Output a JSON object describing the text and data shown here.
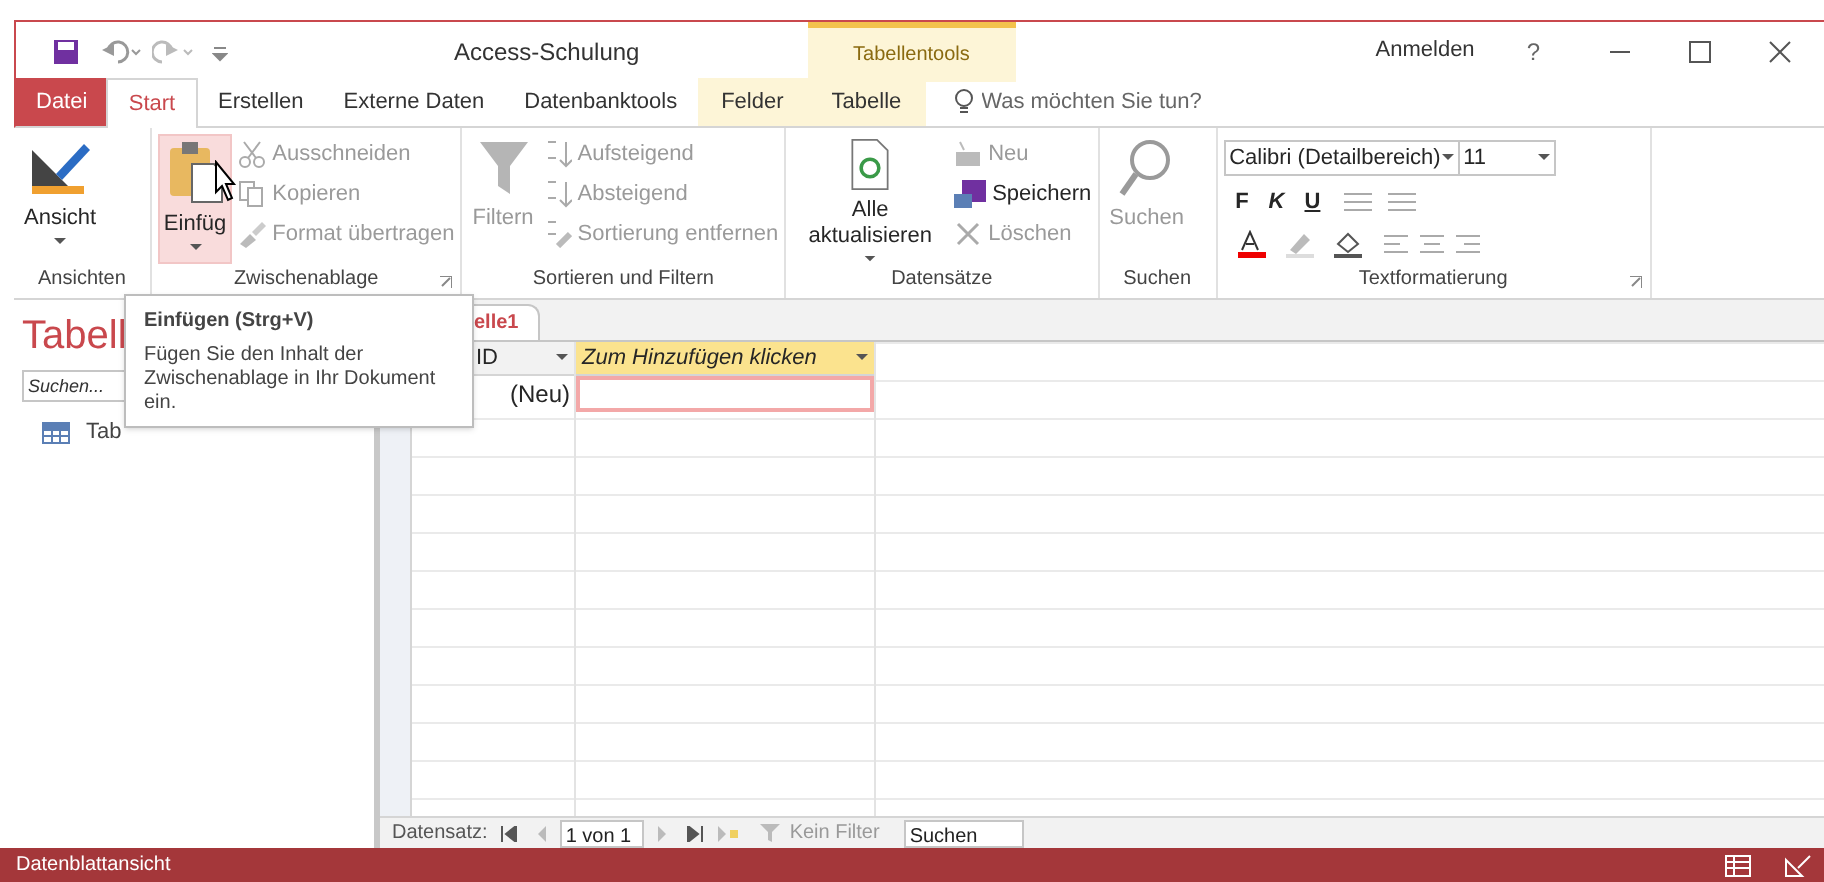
{
  "title_bar": {
    "title": "Access-Schulung",
    "context_group": "Tabellentools",
    "sign_in": "Anmelden",
    "help": "?"
  },
  "tabs": [
    {
      "label": "Datei",
      "kind": "file",
      "selected": false
    },
    {
      "label": "Start",
      "kind": "normal",
      "selected": true
    },
    {
      "label": "Erstellen",
      "kind": "normal",
      "selected": false
    },
    {
      "label": "Externe Daten",
      "kind": "normal",
      "selected": false
    },
    {
      "label": "Datenbanktools",
      "kind": "normal",
      "selected": false
    },
    {
      "label": "Felder",
      "kind": "contextual",
      "selected": false
    },
    {
      "label": "Tabelle",
      "kind": "contextual",
      "selected": false
    }
  ],
  "tell_me": {
    "placeholder": "Was möchten Sie tun?"
  },
  "ribbon": {
    "groups": [
      {
        "label": "Ansichten",
        "large": {
          "label": "Ansicht",
          "kind": "view",
          "dropdown": true,
          "disabled": false,
          "hovered": false
        }
      },
      {
        "label": "Zwischenablage",
        "launcher": true,
        "large": {
          "label": "Einfüg",
          "kind": "paste",
          "dropdown": true,
          "disabled": false,
          "hovered": true
        },
        "small": [
          {
            "label": "Ausschneiden",
            "kind": "cut",
            "disabled": true
          },
          {
            "label": "Kopieren",
            "kind": "copy",
            "disabled": true
          },
          {
            "label": "Format übertragen",
            "kind": "brush",
            "disabled": true
          }
        ]
      },
      {
        "label": "Sortieren und Filtern",
        "large": {
          "label": "Filtern",
          "kind": "filter",
          "dropdown": false,
          "disabled": true,
          "hovered": false
        },
        "small": [
          {
            "label": "Aufsteigend",
            "kind": "sortasc",
            "disabled": true
          },
          {
            "label": "Absteigend",
            "kind": "sortdesc",
            "disabled": true
          },
          {
            "label": "Sortierung entfernen",
            "kind": "sortclear",
            "disabled": true
          }
        ]
      },
      {
        "label": "Datensätze",
        "large": {
          "label": "Alle aktualisieren",
          "kind": "refresh",
          "dropdown": true,
          "disabled": false,
          "hovered": false
        },
        "small": [
          {
            "label": "Neu",
            "kind": "new",
            "disabled": true
          },
          {
            "label": "Speichern",
            "kind": "save",
            "disabled": false
          },
          {
            "label": "Löschen",
            "kind": "delete",
            "disabled": true
          }
        ]
      },
      {
        "label": "Suchen",
        "large": {
          "label": "Suchen",
          "kind": "search",
          "dropdown": false,
          "disabled": true,
          "hovered": false
        }
      },
      {
        "label": "Textformatierung",
        "launcher": true,
        "font": {
          "name": "Calibri (Detailbereich)",
          "size": "11",
          "bold": "F",
          "italic": "K",
          "underline": "U"
        }
      }
    ]
  },
  "nav_pane": {
    "title": "Tabell",
    "search": {
      "placeholder": "Suchen..."
    },
    "items": [
      {
        "label": "Tab"
      }
    ]
  },
  "tooltip": {
    "title": "Einfügen (Strg+V)",
    "body": "Fügen Sie den Inhalt der Zwischenablage in Ihr Dokument ein."
  },
  "document": {
    "tab": "elle1",
    "columns": [
      {
        "label": "ID",
        "kind": "field"
      },
      {
        "label": "Zum Hinzufügen klicken",
        "kind": "add"
      }
    ],
    "new_row": "(Neu)"
  },
  "record_nav": {
    "label": "Datensatz:",
    "position": "1 von 1",
    "filter": "Kein Filter",
    "search": "Suchen"
  },
  "status_bar": {
    "text": "Datenblattansicht"
  }
}
